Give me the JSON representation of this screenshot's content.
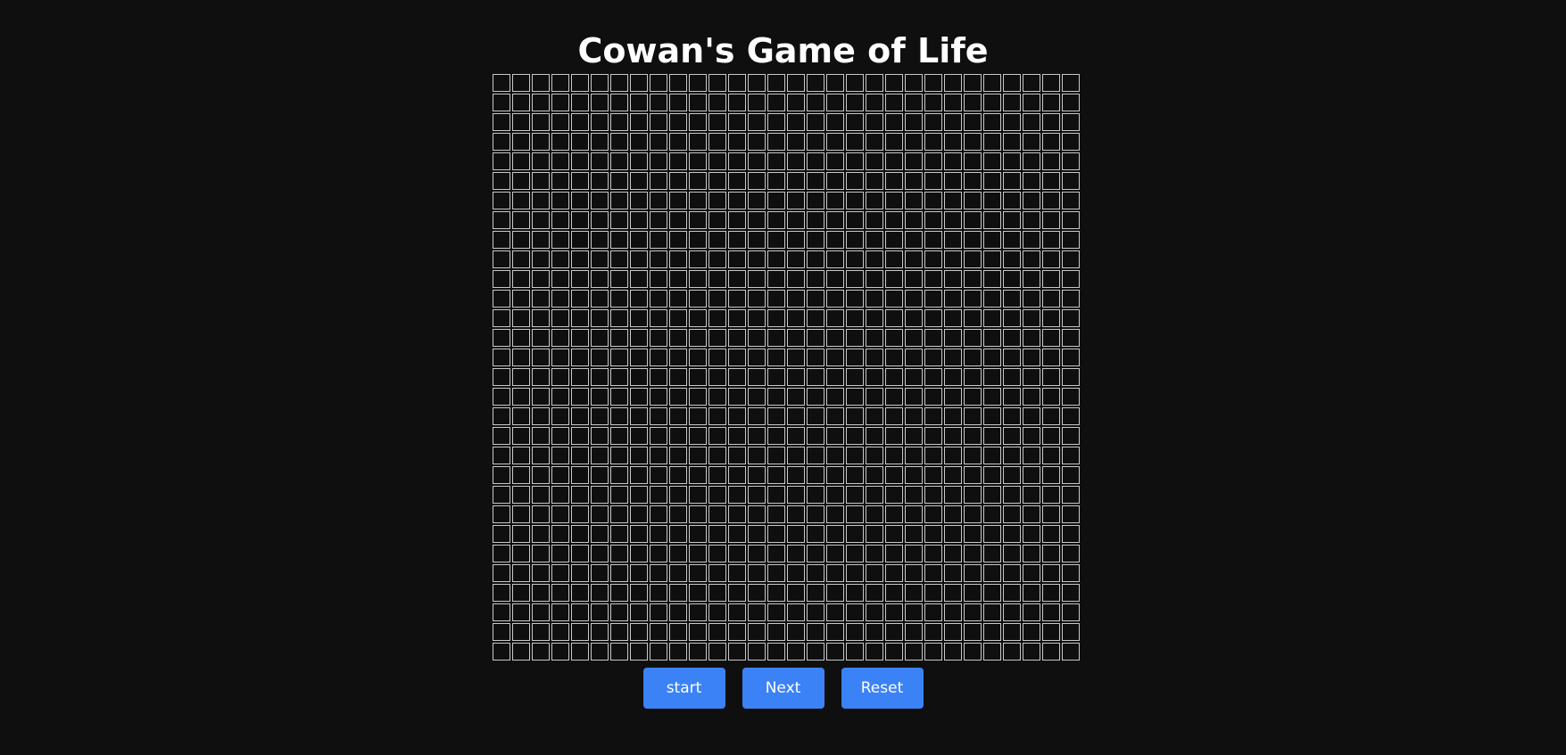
{
  "title": "Cowan's Game of Life",
  "board": {
    "rows": 30,
    "cols": 30,
    "alive_cells": []
  },
  "controls": {
    "start_label": "start",
    "next_label": "Next",
    "reset_label": "Reset"
  },
  "colors": {
    "background": "#0f0f0f",
    "cell_border": "#c8c8c8",
    "button": "#3b82f6",
    "text": "#ffffff"
  }
}
